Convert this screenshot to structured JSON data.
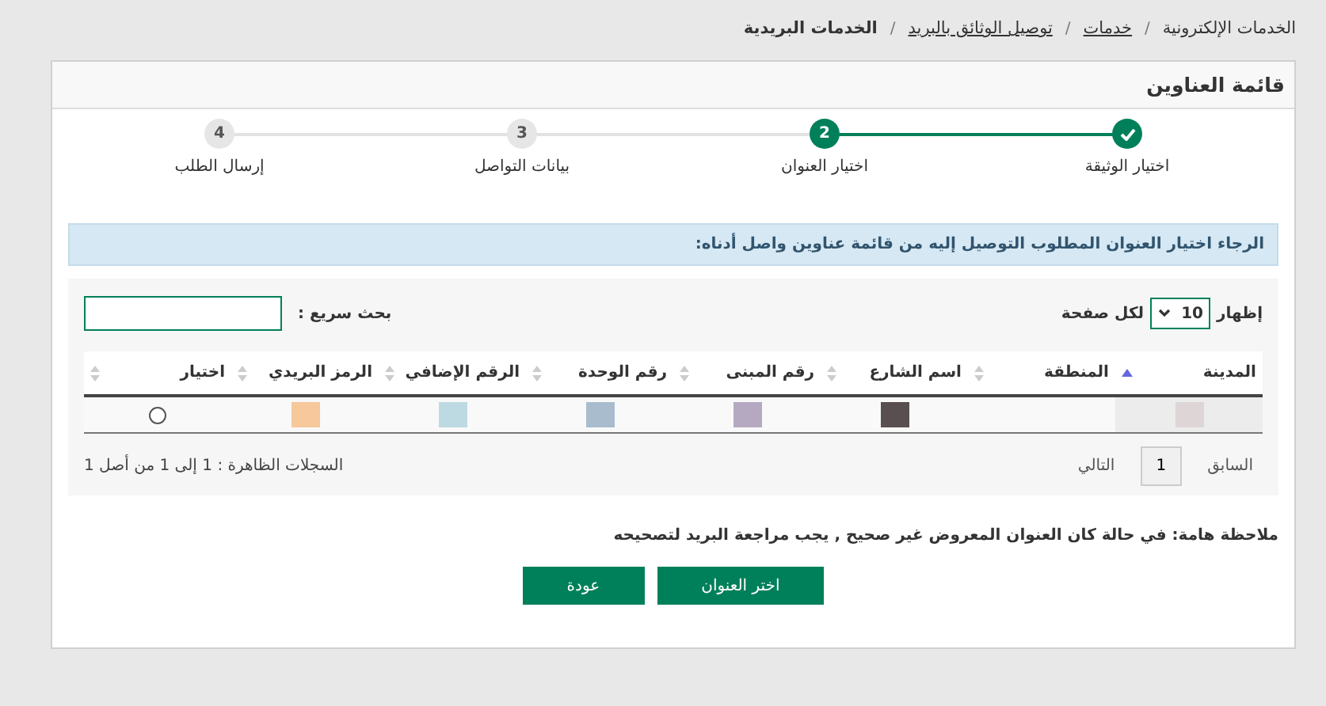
{
  "breadcrumb": [
    {
      "label": "الخدمات الإلكترونية",
      "kind": "plain"
    },
    {
      "label": "خدمات",
      "kind": "link"
    },
    {
      "label": "توصيل الوثائق بالبريد",
      "kind": "link"
    },
    {
      "label": "الخدمات البريدية",
      "kind": "current"
    }
  ],
  "panel": {
    "title": "قائمة العناوين"
  },
  "breadcrumb_separator": "/",
  "steps": [
    {
      "label": "اختيار الوثيقة",
      "done": true,
      "reached": true
    },
    {
      "number": "2",
      "label": "اختيار العنوان",
      "done": false,
      "reached": true
    },
    {
      "number": "3",
      "label": "بيانات التواصل",
      "done": false,
      "reached": false
    },
    {
      "number": "4",
      "label": "إرسال الطلب",
      "done": false,
      "reached": false
    }
  ],
  "info": "الرجاء اختيار العنوان المطلوب التوصيل إليه من قائمة عناوين واصل أدناه:",
  "page_size": {
    "prefix": "إظهار",
    "value": "10",
    "suffix": "لكل صفحة"
  },
  "search": {
    "label": "بحث سريع :"
  },
  "table": {
    "columns": [
      {
        "label": "المدينة",
        "sorted": true
      },
      {
        "label": "المنطقة",
        "sorted": false
      },
      {
        "label": "اسم الشارع",
        "sorted": false
      },
      {
        "label": "رقم المبنى",
        "sorted": false
      },
      {
        "label": "رقم الوحدة",
        "sorted": false
      },
      {
        "label": "الرقم الإضافي",
        "sorted": false
      },
      {
        "label": "الرمز البريدي",
        "sorted": false
      },
      {
        "label": "اختيار",
        "sorted": false
      }
    ],
    "rows": [
      {
        "cells": [
          {
            "kind": "swatch",
            "color": "#ddd5d6"
          },
          {
            "kind": "blank"
          },
          {
            "kind": "swatch",
            "color": "#5a4f50"
          },
          {
            "kind": "swatch",
            "color": "#b5a9c2"
          },
          {
            "kind": "swatch",
            "color": "#a9bccd"
          },
          {
            "kind": "swatch",
            "color": "#bddae2"
          },
          {
            "kind": "swatch",
            "color": "#f6c89b"
          },
          {
            "kind": "radio",
            "selected": false
          }
        ]
      }
    ]
  },
  "pagination": {
    "previous": "السابق",
    "page": "1",
    "next": "التالي",
    "summary": "السجلات الظاهرة : 1 إلى 1 من أصل 1"
  },
  "note": "ملاحظة هامة: في حالة كان العنوان المعروض غير صحيح , يجب مراجعة البريد لتصحيحه",
  "buttons": [
    "اختر العنوان",
    "عودة"
  ]
}
